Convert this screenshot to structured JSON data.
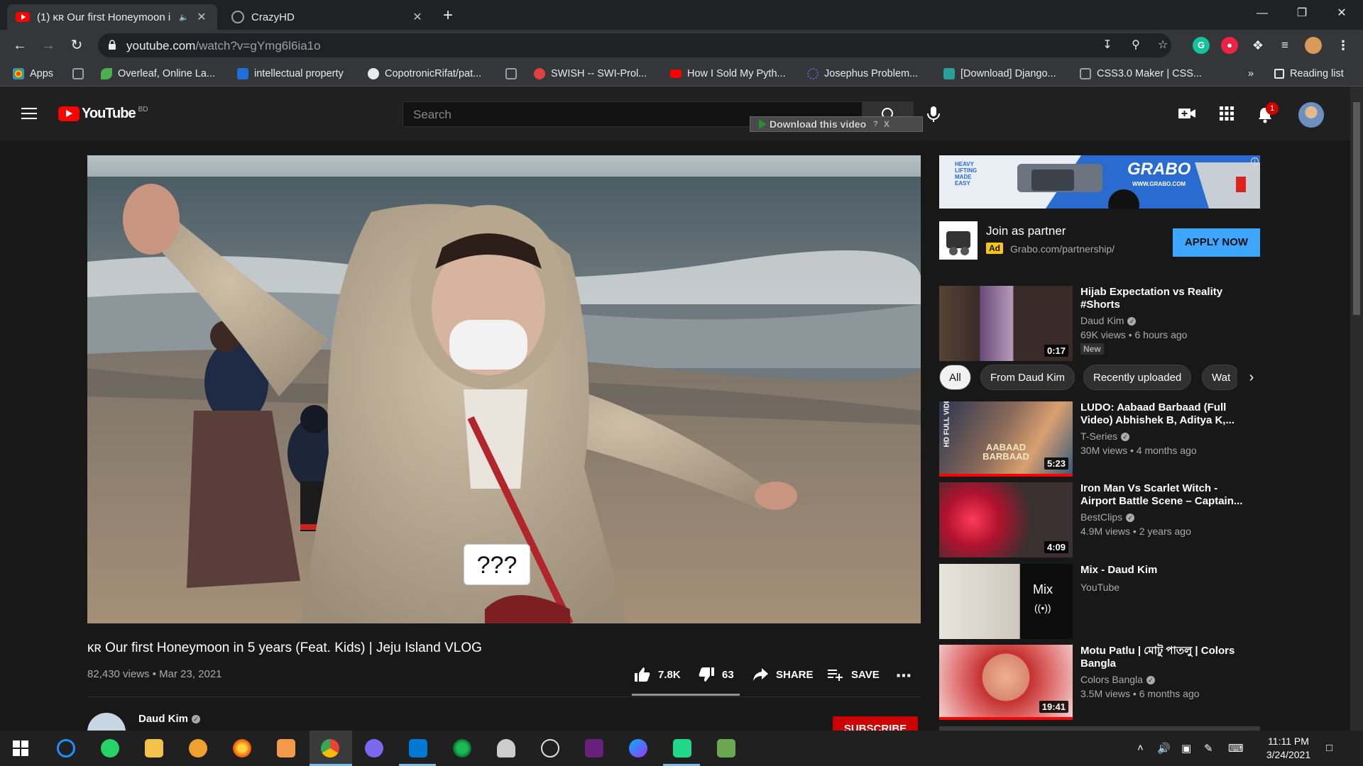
{
  "browser": {
    "tabs": [
      {
        "title": "(1) ᴋʀ Our first Honeymoon i",
        "active": true
      },
      {
        "title": "CrazyHD",
        "active": false
      }
    ],
    "new_tab": "+",
    "url_host": "youtube.com",
    "url_path": "/watch?v=gYmg6l6ia1o",
    "bookmarks": [
      {
        "label": "Apps",
        "color": "#4285f4"
      },
      {
        "label": "",
        "color": "#9aa0a6"
      },
      {
        "label": "Overleaf, Online La...",
        "color": "#4cae4c"
      },
      {
        "label": "intellectual property",
        "color": "#1e6fd9"
      },
      {
        "label": "CopotronicRifat/pat...",
        "color": "#e8eaed"
      },
      {
        "label": "",
        "color": "#9aa0a6"
      },
      {
        "label": "SWISH -- SWI-Prol...",
        "color": "#e04040"
      },
      {
        "label": "How I Sold My Pyth...",
        "color": "#ff0000"
      },
      {
        "label": "Josephus Problem...",
        "color": "#6a5acd"
      },
      {
        "label": "[Download] Django...",
        "color": "#2aa198"
      },
      {
        "label": "CSS3.0 Maker | CSS...",
        "color": "#9aa0a6"
      }
    ],
    "more_bookmarks": "»",
    "reading_list": "Reading list"
  },
  "youtube": {
    "logo_text": "YouTube",
    "country_code": "BD",
    "search_placeholder": "Search",
    "download_bar": "Download this video",
    "download_help": "?",
    "download_close": "X",
    "notification_count": "1",
    "video": {
      "title": "ᴋʀ Our first Honeymoon in 5 years (Feat. Kids) | Jeju Island VLOG",
      "meta": "82,430 views • Mar 23, 2021",
      "caption": "???",
      "likes": "7.8K",
      "dislikes": "63",
      "share": "SHARE",
      "save": "SAVE",
      "like_ratio": 0.99
    },
    "channel": {
      "name": "Daud Kim",
      "subscribe": "SUBSCRIBE"
    },
    "ad": {
      "title": "Join as partner",
      "badge": "Ad",
      "url": "Grabo.com/partnership/",
      "cta": "APPLY NOW",
      "banner_brand": "GRABO",
      "banner_tagline_1": "HEAVY",
      "banner_tagline_2": "LIFTING",
      "banner_tagline_3": "MADE",
      "banner_tagline_4": "EASY",
      "banner_url": "WWW.GRABO.COM"
    },
    "chips": [
      "All",
      "From Daud Kim",
      "Recently uploaded",
      "Wat"
    ],
    "recommendations": [
      {
        "title": "Hijab Expectation vs Reality #Shorts",
        "channel": "Daud Kim",
        "verified": true,
        "views": "69K views • 6 hours ago",
        "duration": "0:17",
        "badge": "New"
      },
      {
        "title": "LUDO: Aabaad Barbaad (Full Video) Abhishek B, Aditya K,...",
        "channel": "T-Series",
        "verified": true,
        "views": "30M views • 4 months ago",
        "duration": "5:23",
        "thumb_text": "AABAAD BARBAAD",
        "side_text": "HD FULL VIDEO"
      },
      {
        "title": "Iron Man Vs Scarlet Witch - Airport Battle Scene – Captain...",
        "channel": "BestClips",
        "verified": true,
        "views": "4.9M views • 2 years ago",
        "duration": "4:09"
      },
      {
        "title": "Mix - Daud Kim",
        "channel": "YouTube",
        "verified": false,
        "views": "",
        "mix_label": "Mix",
        "mix_icon": "((•))"
      },
      {
        "title": "Motu Patlu | মোটু পাতলু | Colors Bangla",
        "channel": "Colors Bangla",
        "verified": true,
        "views": "3.5M views • 6 months ago",
        "duration": "19:41"
      }
    ]
  },
  "taskbar": {
    "time": "11:11 PM",
    "date": "3/24/2021"
  }
}
